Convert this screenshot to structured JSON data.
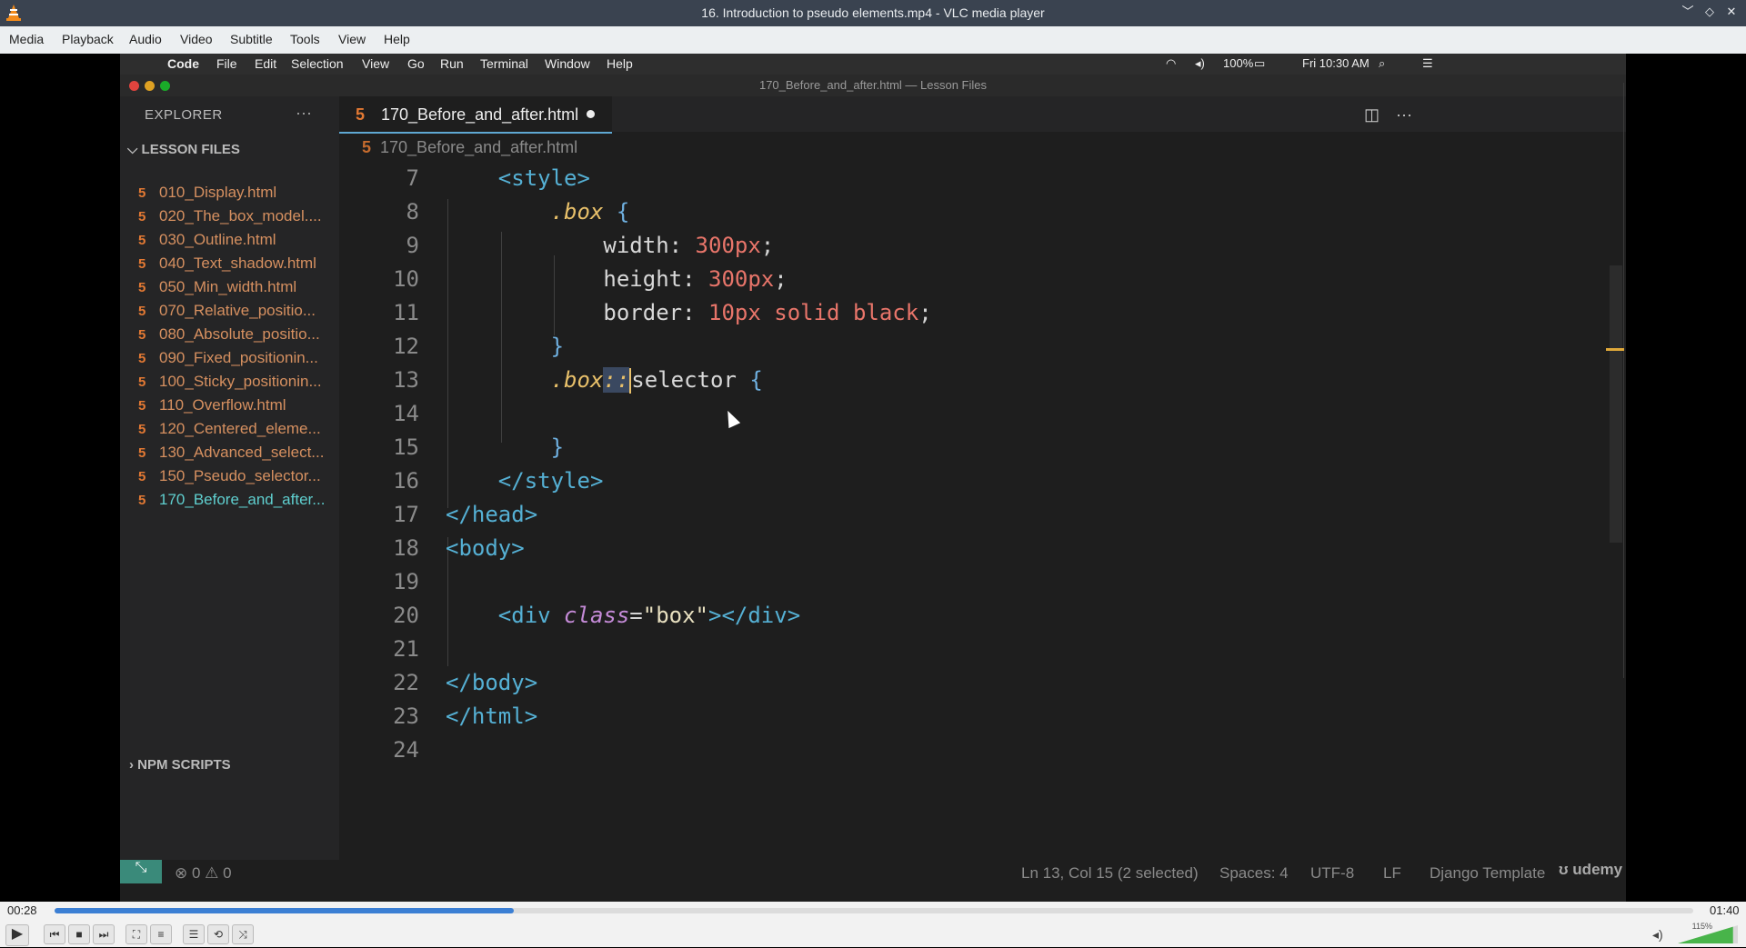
{
  "window": {
    "title": "16. Introduction to pseudo elements.mp4 - VLC media player"
  },
  "menu": [
    "Media",
    "Playback",
    "Audio",
    "Video",
    "Subtitle",
    "Tools",
    "View",
    "Help"
  ],
  "mac_menu": [
    "Code",
    "File",
    "Edit",
    "Selection",
    "View",
    "Go",
    "Run",
    "Terminal",
    "Window",
    "Help"
  ],
  "mac_status": {
    "battery": "100%",
    "clock": "Fri 10:30 AM"
  },
  "vscode": {
    "window_title": "170_Before_and_after.html — Lesson Files",
    "explorer_title": "EXPLORER",
    "explorer_more": "···",
    "section": "LESSON FILES",
    "section_bottom": "NPM SCRIPTS",
    "files": [
      "010_Display.html",
      "020_The_box_model....",
      "030_Outline.html",
      "040_Text_shadow.html",
      "050_Min_width.html",
      "070_Relative_positio...",
      "080_Absolute_positio...",
      "090_Fixed_positionin...",
      "100_Sticky_positionin...",
      "110_Overflow.html",
      "120_Centered_eleme...",
      "130_Advanced_select...",
      "150_Pseudo_selector...",
      "170_Before_and_after..."
    ],
    "active_file_index": 13,
    "tab_label": "170_Before_and_after.html",
    "breadcrumb": "170_Before_and_after.html",
    "line_numbers": [
      "7",
      "8",
      "9",
      "10",
      "11",
      "12",
      "13",
      "14",
      "15",
      "16",
      "17",
      "18",
      "19",
      "20",
      "21",
      "22",
      "23",
      "24"
    ],
    "status": {
      "problems": "⊗ 0 ⚠ 0",
      "position": "Ln 13, Col 15 (2 selected)",
      "spaces": "Spaces: 4",
      "encoding": "UTF-8",
      "eol": "LF",
      "language": "Django Template",
      "brand": "udemy"
    }
  },
  "player": {
    "elapsed": "00:28",
    "total": "01:40",
    "progress": 0.28,
    "volume_label": "115%",
    "volume": 1.15
  },
  "icons": {
    "app": "vlc-cone-icon",
    "play": "play-icon",
    "prev": "previous-icon",
    "stop": "stop-icon",
    "next": "next-icon",
    "fullscreen": "fullscreen-icon",
    "extended": "extended-settings-icon",
    "playlist": "playlist-icon",
    "loop": "loop-icon",
    "shuffle": "shuffle-icon",
    "mute": "speaker-icon"
  },
  "colors": {
    "accent": "#3b7fd4",
    "titlebar": "#3a4350",
    "vlc_orange": "#f28b1c"
  }
}
